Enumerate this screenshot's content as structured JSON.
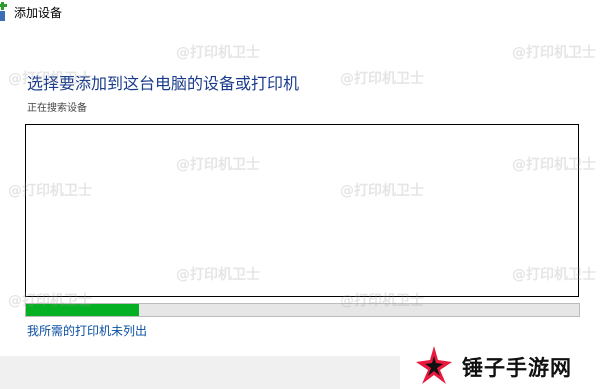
{
  "window": {
    "title": "添加设备"
  },
  "main": {
    "heading": "选择要添加到这台电脑的设备或打印机",
    "status": "正在搜索设备",
    "progress_fraction": 0.205,
    "link": "我所需的打印机未列出"
  },
  "watermark": {
    "text": "@打印机卫士"
  },
  "brand": {
    "name": "锤子手游网"
  },
  "colors": {
    "accent": "#1a3c8c",
    "progress": "#06b025",
    "link": "#0a4fa3",
    "brand_red": "#e8193c"
  }
}
